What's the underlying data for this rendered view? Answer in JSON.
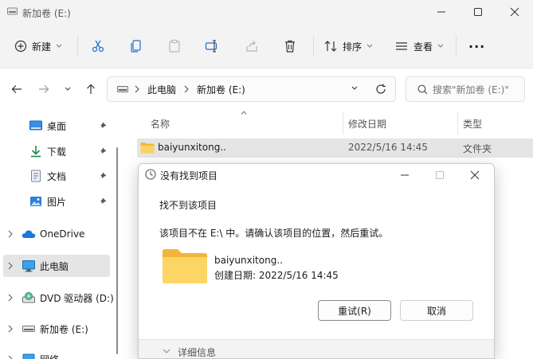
{
  "window": {
    "title": "新加卷 (E:)"
  },
  "toolbar": {
    "new_label": "新建",
    "sort_label": "排序",
    "view_label": "查看",
    "more_label": "···"
  },
  "address": {
    "crumbs": [
      "此电脑",
      "新加卷 (E:)"
    ],
    "search_placeholder": "搜索\"新加卷 (E:)\""
  },
  "sidebar": {
    "quick_access": [
      {
        "label": "桌面",
        "icon": "desktop-icon"
      },
      {
        "label": "下载",
        "icon": "download-icon"
      },
      {
        "label": "文档",
        "icon": "document-icon"
      },
      {
        "label": "图片",
        "icon": "picture-icon"
      }
    ],
    "tree": [
      {
        "label": "OneDrive",
        "icon": "cloud-icon"
      },
      {
        "label": "此电脑",
        "icon": "monitor-icon"
      },
      {
        "label": "DVD 驱动器 (D:)",
        "icon": "dvd-icon"
      },
      {
        "label": "新加卷 (E:)",
        "icon": "drive-icon"
      },
      {
        "label": "网络",
        "icon": "network-icon"
      }
    ]
  },
  "columns": {
    "name": "名称",
    "modified": "修改日期",
    "type": "类型"
  },
  "files": [
    {
      "name": "baiyunxitong..",
      "modified": "2022/5/16 14:45",
      "type": "文件夹"
    }
  ],
  "dialog": {
    "title": "没有找到项目",
    "heading": "找不到该项目",
    "message": "该项目不在 E:\\ 中。请确认该项目的位置，然后重试。",
    "item_name": "baiyunxitong..",
    "item_created": "创建日期: 2022/5/16 14:45",
    "retry_label": "重试(R)",
    "cancel_label": "取消",
    "details_label": "详细信息"
  },
  "colors": {
    "accent": "#0067c0",
    "folder": "#f8c94e",
    "selection": "#e5e5e5"
  }
}
